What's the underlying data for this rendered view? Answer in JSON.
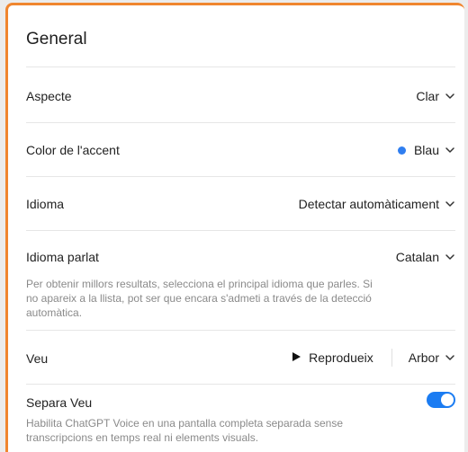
{
  "settings": {
    "title": "General",
    "appearance": {
      "label": "Aspecte",
      "value": "Clar"
    },
    "accent": {
      "label": "Color de l'accent",
      "value": "Blau",
      "dot_color": "#2f7ef0"
    },
    "language": {
      "label": "Idioma",
      "value": "Detectar automàticament"
    },
    "spoken_language": {
      "label": "Idioma parlat",
      "value": "Catalan",
      "help_line1": "Per obtenir millors resultats, selecciona el principal idioma que parles. Si",
      "help_line2": "no apareix a la llista, pot ser que encara s'admeti a través de la detecció",
      "help_line3": "automàtica."
    },
    "voice": {
      "label": "Veu",
      "play_label": "Reprodueix",
      "value": "Arbor"
    },
    "separate_voice": {
      "label": "Separa Veu",
      "enabled": true,
      "help_line1": "Habilita ChatGPT Voice en una pantalla completa separada sense",
      "help_line2": "transcripcions en temps real ni elements visuals."
    }
  },
  "colors": {
    "accent": "#1b7cf2",
    "frame_border": "#f0862f"
  },
  "icons": {
    "chevron": "chevron-down-icon",
    "play": "play-icon"
  }
}
